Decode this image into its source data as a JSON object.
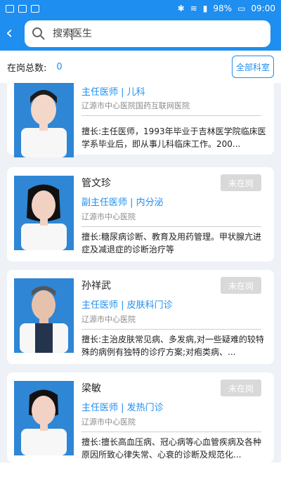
{
  "status_bar": {
    "battery": "98%",
    "time": "09:00"
  },
  "search": {
    "placeholder": "搜索医生"
  },
  "summary": {
    "label": "在岗总数:",
    "count": "0",
    "all_dept_label": "全部科室"
  },
  "doctors": [
    {
      "name": "",
      "status": "",
      "title": "主任医师 | 儿科",
      "hospital": "辽源市中心医院国药互联网医院",
      "specialty": "擅长:主任医师，1993年毕业于吉林医学院临床医学系毕业后，即从事儿科临床工作。200..."
    },
    {
      "name": "管文珍",
      "status": "未在岗",
      "title": "副主任医师 | 内分泌",
      "hospital": "辽源市中心医院",
      "specialty": "擅长:糖尿病诊断、教育及用药管理。甲状腺亢进症及减退症的诊断治疗等"
    },
    {
      "name": "孙祥武",
      "status": "未在岗",
      "title": "主任医师 | 皮肤科门诊",
      "hospital": "辽源市中心医院",
      "specialty": "擅长:主治皮肤常见病、多发病,对一些疑难的较特殊的病例有独特的诊疗方案;对疱类病、..."
    },
    {
      "name": "梁敏",
      "status": "未在岗",
      "title": "主任医师 | 发热门诊",
      "hospital": "辽源市中心医院",
      "specialty": "擅长:擅长高血压病、冠心病等心血管疾病及各种原因所致心律失常、心衰的诊断及规范化..."
    }
  ]
}
